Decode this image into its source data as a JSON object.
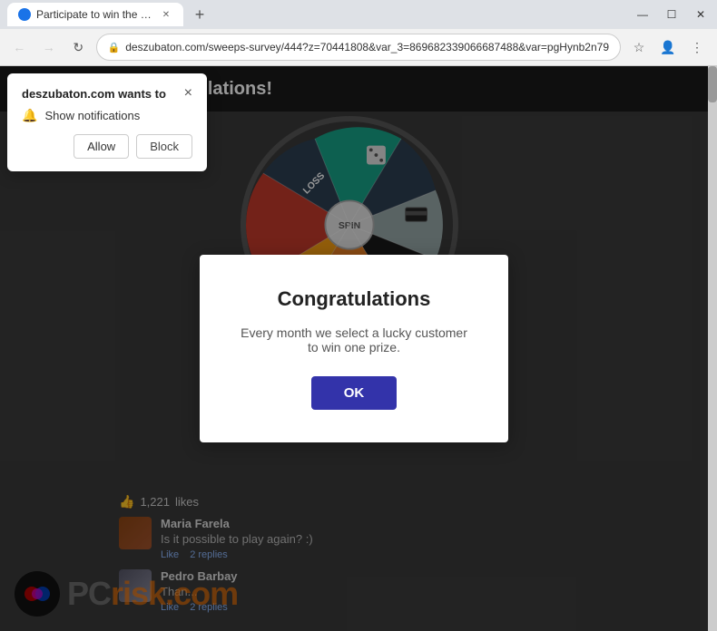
{
  "browser": {
    "tab_title": "Participate to win the prize",
    "url": "deszubaton.com/sweeps-survey/444?z=70441808&var_3=869682339066687488&var=pgHynb2n79",
    "nav_back": "←",
    "nav_forward": "→",
    "nav_reload": "↻",
    "new_tab_icon": "+",
    "win_minimize": "—",
    "win_restore": "☐",
    "win_close": "✕",
    "star_icon": "☆",
    "profile_icon": "👤",
    "menu_icon": "⋮"
  },
  "notification": {
    "title": "deszubaton.com wants to",
    "close_icon": "×",
    "bell_icon": "🔔",
    "label": "Show notifications",
    "allow_btn": "Allow",
    "block_btn": "Block"
  },
  "page": {
    "header_title": "Congratulations!",
    "wheel_label": "SPIN",
    "wheel_loss_label": "LOSS"
  },
  "modal": {
    "title": "Congratulations",
    "text": "Every month we select a lucky customer to win one prize.",
    "ok_btn": "OK"
  },
  "comments": {
    "likes_count": "1,221",
    "likes_label": "likes",
    "items": [
      {
        "name": "Maria Farela",
        "text": "Is it possible to play again? :)",
        "like_label": "Like",
        "replies_label": "2 replies"
      },
      {
        "name": "Pedro Barbay",
        "text": "Than...",
        "like_label": "Like",
        "replies_label": "2 replies"
      }
    ]
  },
  "watermark": {
    "text_pc": "PC",
    "text_risk": "risk",
    "text_com": ".com"
  },
  "colors": {
    "modal_btn": "#3333aa",
    "header_bg": "#1a1a1a",
    "page_bg": "#3a3a3a"
  }
}
